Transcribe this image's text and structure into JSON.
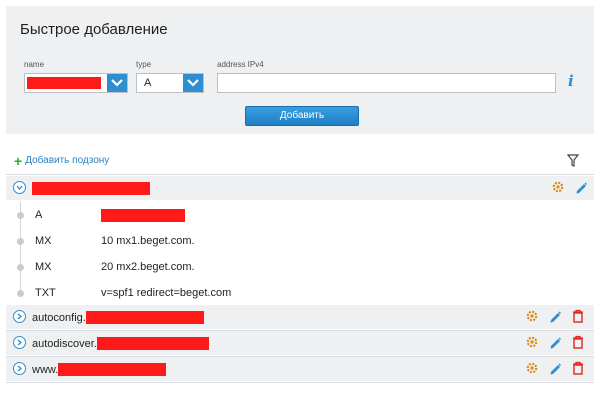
{
  "quick_add": {
    "title": "Быстрое добавление",
    "name_label": "name",
    "type_label": "type",
    "address_label": "address IPv4",
    "type_value": "A",
    "address_value": "",
    "add_button": "Добавить",
    "info_glyph": "i"
  },
  "toolbar": {
    "add_subzone": "Добавить подзону",
    "filter_icon": "filter-icon"
  },
  "main_zone": {
    "records": [
      {
        "type": "A",
        "value": ""
      },
      {
        "type": "MX",
        "value": "10 mx1.beget.com."
      },
      {
        "type": "MX",
        "value": "20 mx2.beget.com."
      },
      {
        "type": "TXT",
        "value": "v=spf1 redirect=beget.com"
      }
    ]
  },
  "subzones": [
    {
      "prefix": "autoconfig."
    },
    {
      "prefix": "autodiscover."
    },
    {
      "prefix": "www."
    }
  ],
  "colors": {
    "accent": "#2f8dd2",
    "redaction": "#ff1a1a",
    "panel_bg": "#eef0f2",
    "delete": "#e0261f"
  }
}
